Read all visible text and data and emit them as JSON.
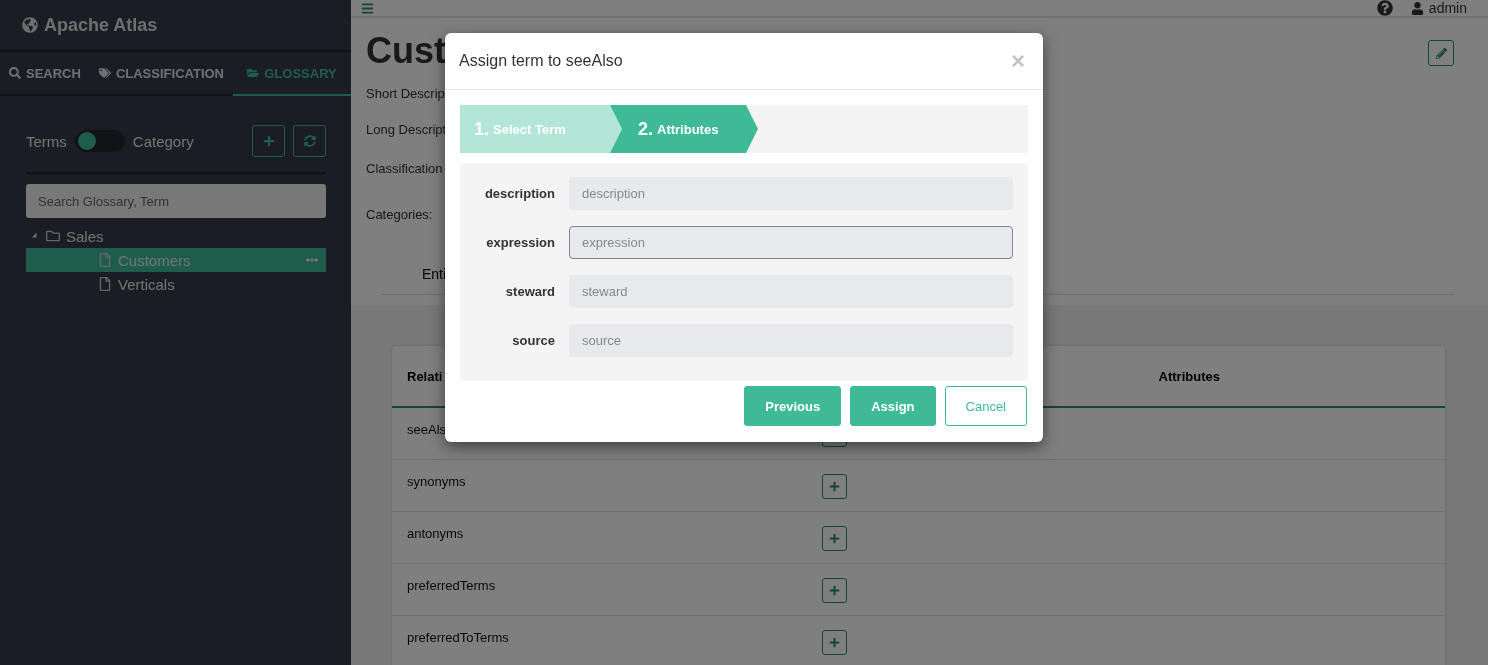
{
  "app": {
    "title": "Apache Atlas"
  },
  "sidebar": {
    "tabs": [
      {
        "label": "SEARCH",
        "selected": false
      },
      {
        "label": "CLASSIFICATION",
        "selected": false
      },
      {
        "label": "GLOSSARY",
        "selected": true
      }
    ],
    "view_toggle": {
      "left_label": "Terms",
      "right_label": "Category",
      "on": false
    },
    "search": {
      "placeholder": "Search Glossary, Term"
    },
    "tree": [
      {
        "label": "Sales",
        "kind": "folder",
        "expanded": true,
        "selected": false,
        "children": [
          {
            "label": "Customers",
            "kind": "term",
            "selected": true
          },
          {
            "label": "Verticals",
            "kind": "term",
            "selected": false
          }
        ]
      }
    ]
  },
  "header": {
    "user": "admin"
  },
  "detail": {
    "title": "Cust",
    "fields": [
      "Short Descrip",
      "Long Descript",
      "Classification",
      "Categories:"
    ],
    "tab": "Enti",
    "table": {
      "columns": [
        "Relati",
        "Attributes"
      ],
      "rows": [
        "seeAls",
        "synonyms",
        "antonyms",
        "preferredTerms",
        "preferredToTerms"
      ]
    }
  },
  "modal": {
    "title": "Assign term to seeAlso",
    "close": "×",
    "steps": [
      {
        "number": "1.",
        "label": "Select Term",
        "selected": false
      },
      {
        "number": "2.",
        "label": "Attributes",
        "selected": true
      }
    ],
    "fields": [
      {
        "label": "description",
        "placeholder": "description",
        "focused": false
      },
      {
        "label": "expression",
        "placeholder": "expression",
        "focused": true
      },
      {
        "label": "steward",
        "placeholder": "steward",
        "focused": false
      },
      {
        "label": "source",
        "placeholder": "source",
        "focused": false
      }
    ],
    "buttons": [
      {
        "label": "Previous",
        "kind": "primary"
      },
      {
        "label": "Assign",
        "kind": "primary"
      },
      {
        "label": "Cancel",
        "kind": "outline"
      }
    ]
  }
}
